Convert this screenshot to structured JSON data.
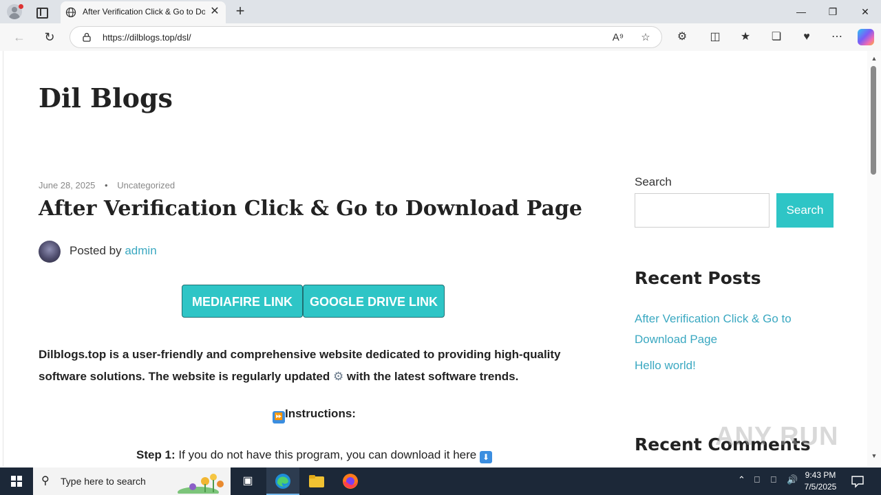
{
  "browser": {
    "tab_title": "After Verification Click & Go to Download Page",
    "url": "https://dilblogs.top/dsl/",
    "new_tab": "+",
    "close_tab": "✕"
  },
  "site": {
    "title": "Dil Blogs"
  },
  "post": {
    "date": "June 28, 2025",
    "category": "Uncategorized",
    "title": "After Verification Click & Go to Download Page",
    "posted_by": "Posted by",
    "author": "admin",
    "buttons": {
      "mediafire": "MEDIAFIRE LINK",
      "gdrive": "GOOGLE DRIVE LINK"
    },
    "intro_part1": "Dilblogs.top is a user-friendly and comprehensive website dedicated to providing high-quality software solutions. The website is regularly updated",
    "intro_part2": "with the latest software trends.",
    "instructions": "Instructions:",
    "step1_label": "Step 1:",
    "step1_text": "If you do not have this program, you can download it here"
  },
  "sidebar": {
    "search_label": "Search",
    "search_button": "Search",
    "recent_posts_heading": "Recent Posts",
    "recent_posts": [
      "After Verification Click & Go to Download Page",
      "Hello world!"
    ],
    "recent_comments_heading": "Recent Comments"
  },
  "watermark": "ANY RUN",
  "taskbar": {
    "search_placeholder": "Type here to search",
    "time": "9:43 PM",
    "date": "7/5/2025"
  },
  "colors": {
    "accent": "#2ec5c6",
    "link": "#3aa8c1",
    "taskbar": "#1c2838"
  },
  "icons": [
    "globe-icon",
    "lock-icon",
    "refresh-icon",
    "back-icon",
    "read-aloud-icon",
    "favorite-star-icon",
    "extensions-icon",
    "split-screen-icon",
    "favorites-icon",
    "collections-icon",
    "browser-essentials-icon",
    "more-icon",
    "copilot-icon",
    "gear-icon",
    "fast-forward-icon",
    "down-arrow-icon",
    "windows-logo-icon",
    "search-icon",
    "task-view-icon",
    "edge-icon",
    "file-explorer-icon",
    "firefox-icon"
  ]
}
